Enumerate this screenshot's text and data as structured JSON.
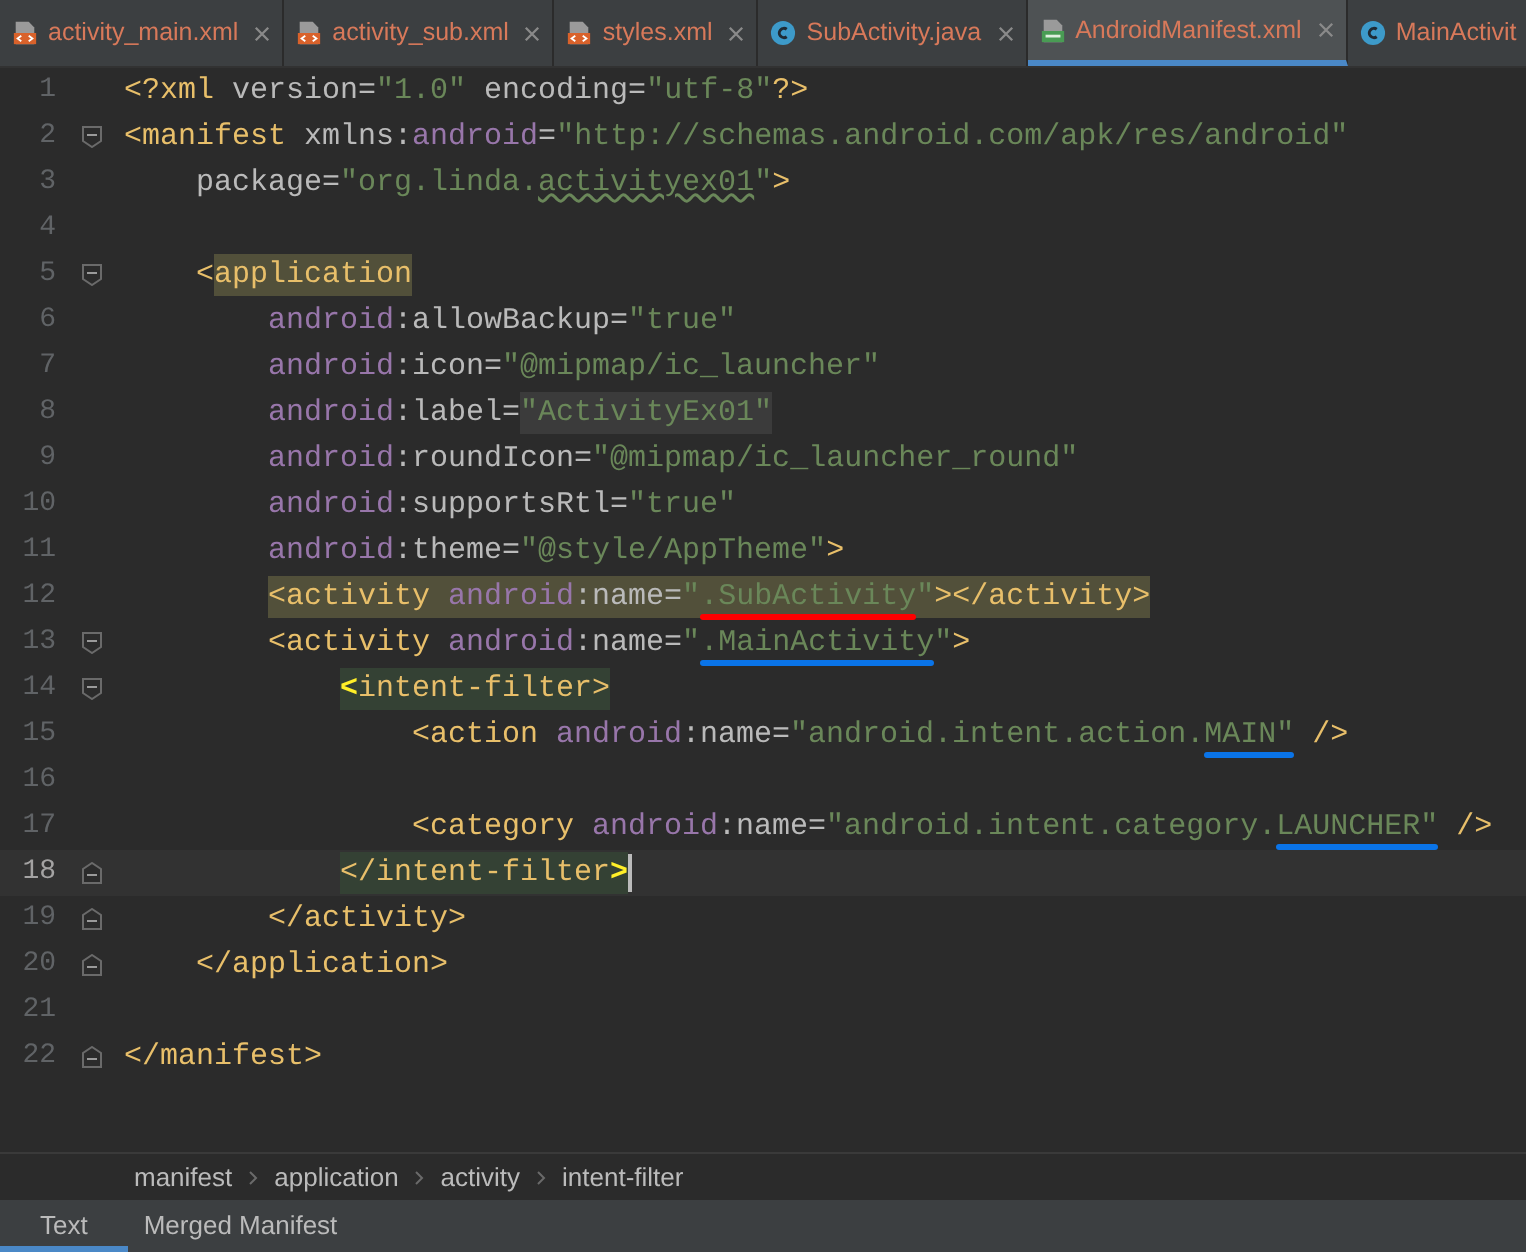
{
  "tabs": [
    {
      "label": "activity_main.xml",
      "kind": "xml",
      "selected": false
    },
    {
      "label": "activity_sub.xml",
      "kind": "xml",
      "selected": false
    },
    {
      "label": "styles.xml",
      "kind": "xml",
      "selected": false
    },
    {
      "label": "SubActivity.java",
      "kind": "class",
      "selected": false
    },
    {
      "label": "AndroidManifest.xml",
      "kind": "manifest",
      "selected": true
    },
    {
      "label": "MainActivit",
      "kind": "class",
      "selected": false
    }
  ],
  "editor": {
    "lines": [
      {
        "number": "1",
        "current": false,
        "tokens": [
          {
            "kind": "tag",
            "text": "<?xml "
          },
          {
            "kind": "attr",
            "text": "version="
          },
          {
            "kind": "value",
            "text": "\"1.0\" "
          },
          {
            "kind": "attr",
            "text": "encoding="
          },
          {
            "kind": "value",
            "text": "\"utf-8\""
          },
          {
            "kind": "tag",
            "text": "?>"
          }
        ]
      },
      {
        "number": "2",
        "fold_open": true,
        "current": false,
        "tokens": [
          {
            "kind": "tag",
            "text": "<manifest "
          },
          {
            "kind": "attr",
            "text": "xmlns:"
          },
          {
            "kind": "ns",
            "text": "android"
          },
          {
            "kind": "attr",
            "text": "="
          },
          {
            "kind": "value",
            "text": "\"http://schemas.android.com/apk/res/android\""
          }
        ],
        "children": [
          {
            "number": "3",
            "current": false,
            "tokens": [
              {
                "kind": "attr",
                "text": "package="
              },
              {
                "kind": "value",
                "text": "\"org.linda."
              },
              {
                "kind": "value",
                "text": "activityex01",
                "typo": true
              },
              {
                "kind": "value",
                "text": "\""
              },
              {
                "kind": "tag",
                "text": ">"
              }
            ]
          },
          {
            "number": "4",
            "current": false
          },
          {
            "number": "5",
            "fold_open": true,
            "current": false,
            "tokens": [
              {
                "kind": "tag",
                "text": "<"
              },
              {
                "kind": "tag",
                "text": "application",
                "highlight": {
                  "color": "#52503a"
                }
              }
            ],
            "children": [
              {
                "number": "6",
                "current": false,
                "tokens": [
                  {
                    "kind": "ns",
                    "text": "android"
                  },
                  {
                    "kind": "attr",
                    "text": ":allowBackup="
                  },
                  {
                    "kind": "value",
                    "text": "\"true\""
                  }
                ]
              },
              {
                "number": "7",
                "current": false,
                "tokens": [
                  {
                    "kind": "ns",
                    "text": "android"
                  },
                  {
                    "kind": "attr",
                    "text": ":icon="
                  },
                  {
                    "kind": "value",
                    "text": "\"@mipmap/ic_launcher\""
                  }
                ]
              },
              {
                "number": "8",
                "current": false,
                "tokens": [
                  {
                    "kind": "ns",
                    "text": "android"
                  },
                  {
                    "kind": "attr",
                    "text": ":label="
                  },
                  {
                    "kind": "value",
                    "text": "\"ActivityEx01\"",
                    "highlight": {
                      "color": "#3b3b3b"
                    }
                  }
                ]
              },
              {
                "number": "9",
                "current": false,
                "tokens": [
                  {
                    "kind": "ns",
                    "text": "android"
                  },
                  {
                    "kind": "attr",
                    "text": ":roundIcon="
                  },
                  {
                    "kind": "value",
                    "text": "\"@mipmap/ic_launcher_round\""
                  }
                ]
              },
              {
                "number": "10",
                "current": false,
                "tokens": [
                  {
                    "kind": "ns",
                    "text": "android"
                  },
                  {
                    "kind": "attr",
                    "text": ":supportsRtl="
                  },
                  {
                    "kind": "value",
                    "text": "\"true\""
                  }
                ]
              },
              {
                "number": "11",
                "current": false,
                "tokens": [
                  {
                    "kind": "ns",
                    "text": "android"
                  },
                  {
                    "kind": "attr",
                    "text": ":theme="
                  },
                  {
                    "kind": "value",
                    "text": "\"@style/AppTheme\""
                  },
                  {
                    "kind": "tag",
                    "text": ">"
                  }
                ]
              },
              {
                "number": "12",
                "current": false,
                "tokens": [
                  {
                    "kind": "tag",
                    "text": "<activity ",
                    "highlight": {
                      "color": "#52503a"
                    }
                  },
                  {
                    "kind": "ns",
                    "text": "android",
                    "highlight": {
                      "color": "#52503a"
                    }
                  },
                  {
                    "kind": "attr",
                    "text": ":name=",
                    "highlight": {
                      "color": "#52503a"
                    }
                  },
                  {
                    "kind": "value",
                    "text": "\"",
                    "highlight": {
                      "color": "#52503a"
                    }
                  },
                  {
                    "kind": "value",
                    "text": ".SubActivity",
                    "highlight": {
                      "color": "#52503a"
                    },
                    "underline": {
                      "color": "#ff0000"
                    }
                  },
                  {
                    "kind": "value",
                    "text": "\"",
                    "highlight": {
                      "color": "#52503a"
                    }
                  },
                  {
                    "kind": "tag",
                    "text": "></activity>",
                    "highlight": {
                      "color": "#52503a"
                    }
                  }
                ]
              },
              {
                "number": "13",
                "fold_open": true,
                "current": false,
                "tokens": [
                  {
                    "kind": "tag",
                    "text": "<activity "
                  },
                  {
                    "kind": "ns",
                    "text": "android"
                  },
                  {
                    "kind": "attr",
                    "text": ":name="
                  },
                  {
                    "kind": "value",
                    "text": "\""
                  },
                  {
                    "kind": "value",
                    "text": ".MainActivity",
                    "underline": {
                      "color": "#0a74e8"
                    }
                  },
                  {
                    "kind": "value",
                    "text": "\""
                  },
                  {
                    "kind": "tag",
                    "text": ">"
                  }
                ],
                "children": [
                  {
                    "number": "14",
                    "fold_open": true,
                    "current": false,
                    "tokens": [
                      {
                        "kind": "brace",
                        "text": "<",
                        "highlight": {
                          "color": "#344134"
                        }
                      },
                      {
                        "kind": "tag",
                        "text": "intent-filter>",
                        "highlight": {
                          "color": "#344134"
                        }
                      }
                    ],
                    "children": [
                      {
                        "number": "15",
                        "current": false,
                        "tokens": [
                          {
                            "kind": "tag",
                            "text": "<action "
                          },
                          {
                            "kind": "ns",
                            "text": "android"
                          },
                          {
                            "kind": "attr",
                            "text": ":name="
                          },
                          {
                            "kind": "value",
                            "text": "\"android.intent.action."
                          },
                          {
                            "kind": "value",
                            "text": "MAIN\"",
                            "underline": {
                              "color": "#0a74e8"
                            }
                          },
                          {
                            "kind": "tag",
                            "text": " />"
                          }
                        ]
                      },
                      {
                        "number": "16",
                        "current": false
                      },
                      {
                        "number": "17",
                        "current": false,
                        "tokens": [
                          {
                            "kind": "tag",
                            "text": "<category "
                          },
                          {
                            "kind": "ns",
                            "text": "android"
                          },
                          {
                            "kind": "attr",
                            "text": ":name="
                          },
                          {
                            "kind": "value",
                            "text": "\"android.intent.category."
                          },
                          {
                            "kind": "value",
                            "text": "LAUNCHER\"",
                            "underline": {
                              "color": "#0a74e8"
                            }
                          },
                          {
                            "kind": "tag",
                            "text": " />"
                          }
                        ]
                      }
                    ]
                  },
                  {
                    "number": "18",
                    "fold_close": true,
                    "current": true,
                    "tokens": [
                      {
                        "kind": "tag",
                        "text": "</intent-filter",
                        "highlight": {
                          "color": "#344134"
                        }
                      },
                      {
                        "kind": "brace",
                        "text": ">",
                        "highlight": {
                          "color": "#344134"
                        }
                      }
                    ]
                  }
                ]
              },
              {
                "number": "19",
                "fold_close": true,
                "current": false,
                "tokens": [
                  {
                    "kind": "tag",
                    "text": "</activity>"
                  }
                ]
              }
            ]
          },
          {
            "number": "20",
            "fold_close": true,
            "current": false,
            "tokens": [
              {
                "kind": "tag",
                "text": "</application>"
              }
            ]
          },
          {
            "number": "21",
            "current": false
          }
        ]
      },
      {
        "number": "22",
        "fold_close": true,
        "current": false,
        "tokens": [
          {
            "kind": "tag",
            "text": "</manifest>"
          }
        ]
      }
    ]
  },
  "breadcrumbs": [
    "manifest",
    "application",
    "activity",
    "intent-filter"
  ],
  "bottom_tabs": [
    {
      "label": "Text",
      "selected": true
    },
    {
      "label": "Merged Manifest",
      "selected": false
    }
  ]
}
